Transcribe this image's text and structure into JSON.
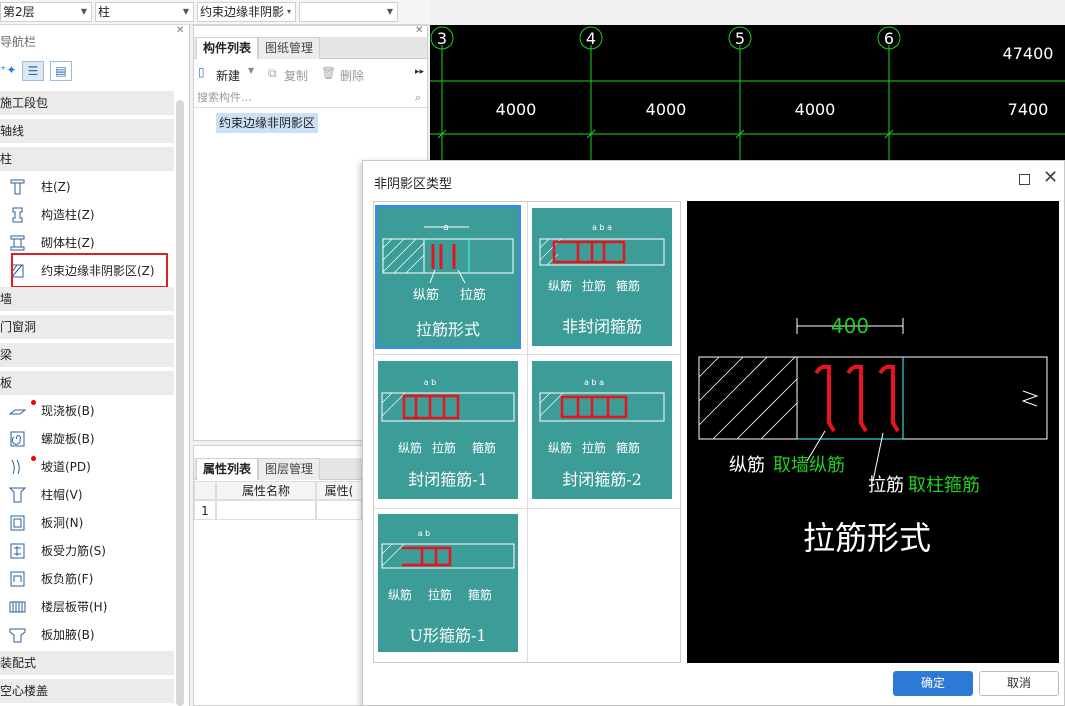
{
  "toolbar": {
    "floor": "第2层",
    "category": "柱",
    "component": "约束边缘非阴影",
    "extra": ""
  },
  "nav": {
    "title": "导航栏",
    "sections": [
      {
        "label": "施工段包"
      },
      {
        "label": "轴线"
      },
      {
        "label": "柱"
      },
      {
        "label": "墙"
      },
      {
        "label": "门窗洞"
      },
      {
        "label": "梁"
      },
      {
        "label": "板"
      },
      {
        "label": "装配式"
      },
      {
        "label": "空心楼盖"
      }
    ],
    "col_items": [
      {
        "label": "柱(Z)",
        "icon": "column-icon"
      },
      {
        "label": "构造柱(Z)",
        "icon": "constructional-column-icon"
      },
      {
        "label": "砌体柱(Z)",
        "icon": "masonry-column-icon"
      },
      {
        "label": "约束边缘非阴影区(Z)",
        "icon": "constraint-edge-icon"
      }
    ],
    "slab_items": [
      {
        "label": "现浇板(B)",
        "icon": "cast-slab-icon"
      },
      {
        "label": "螺旋板(B)",
        "icon": "spiral-slab-icon"
      },
      {
        "label": "坡道(PD)",
        "icon": "ramp-icon"
      },
      {
        "label": "柱帽(V)",
        "icon": "column-cap-icon"
      },
      {
        "label": "板洞(N)",
        "icon": "slab-hole-icon"
      },
      {
        "label": "板受力筋(S)",
        "icon": "slab-main-rebar-icon"
      },
      {
        "label": "板负筋(F)",
        "icon": "slab-negative-rebar-icon"
      },
      {
        "label": "楼层板带(H)",
        "icon": "slab-strip-icon"
      },
      {
        "label": "板加腋(B)",
        "icon": "slab-haunch-icon"
      }
    ]
  },
  "complist": {
    "tab_active": "构件列表",
    "tab_inactive": "图纸管理",
    "new_label": "新建",
    "copy_label": "复制",
    "delete_label": "删除",
    "search_placeholder": "搜索构件...",
    "item": "约束边缘非阴影区"
  },
  "props": {
    "tab_active": "属性列表",
    "tab_inactive": "图层管理",
    "col_name": "属性名称",
    "col_value": "属性(",
    "row_num": "1"
  },
  "cad": {
    "axes": [
      "3",
      "4",
      "5",
      "6"
    ],
    "dims": [
      "4000",
      "4000",
      "4000",
      "7400"
    ],
    "total": "47400"
  },
  "dialog": {
    "title": "非阴影区类型",
    "thumbnails": [
      {
        "label": "拉筋形式",
        "sub": [
          "纵筋",
          "拉筋"
        ]
      },
      {
        "label": "非封闭箍筋",
        "sub": [
          "纵筋",
          "拉筋",
          "箍筋"
        ]
      },
      {
        "label": "封闭箍筋-1",
        "sub": [
          "纵筋",
          "拉筋",
          "箍筋"
        ]
      },
      {
        "label": "封闭箍筋-2",
        "sub": [
          "纵筋",
          "拉筋",
          "箍筋"
        ]
      },
      {
        "label": "U形箍筋-1",
        "sub": [
          "纵筋",
          "拉筋",
          "箍筋"
        ]
      }
    ],
    "preview": {
      "dim": "400",
      "long_bar": "纵筋",
      "long_bar_note": "取墙纵筋",
      "tie": "拉筋",
      "tie_note": "取柱箍筋",
      "title": "拉筋形式"
    },
    "ok": "确定",
    "cancel": "取消"
  },
  "colors": {
    "thumb_bg": "#3c9c98",
    "accent": "#2d7ad6",
    "rebar_red": "#e8141c",
    "cad_green": "#1fcf1f"
  }
}
